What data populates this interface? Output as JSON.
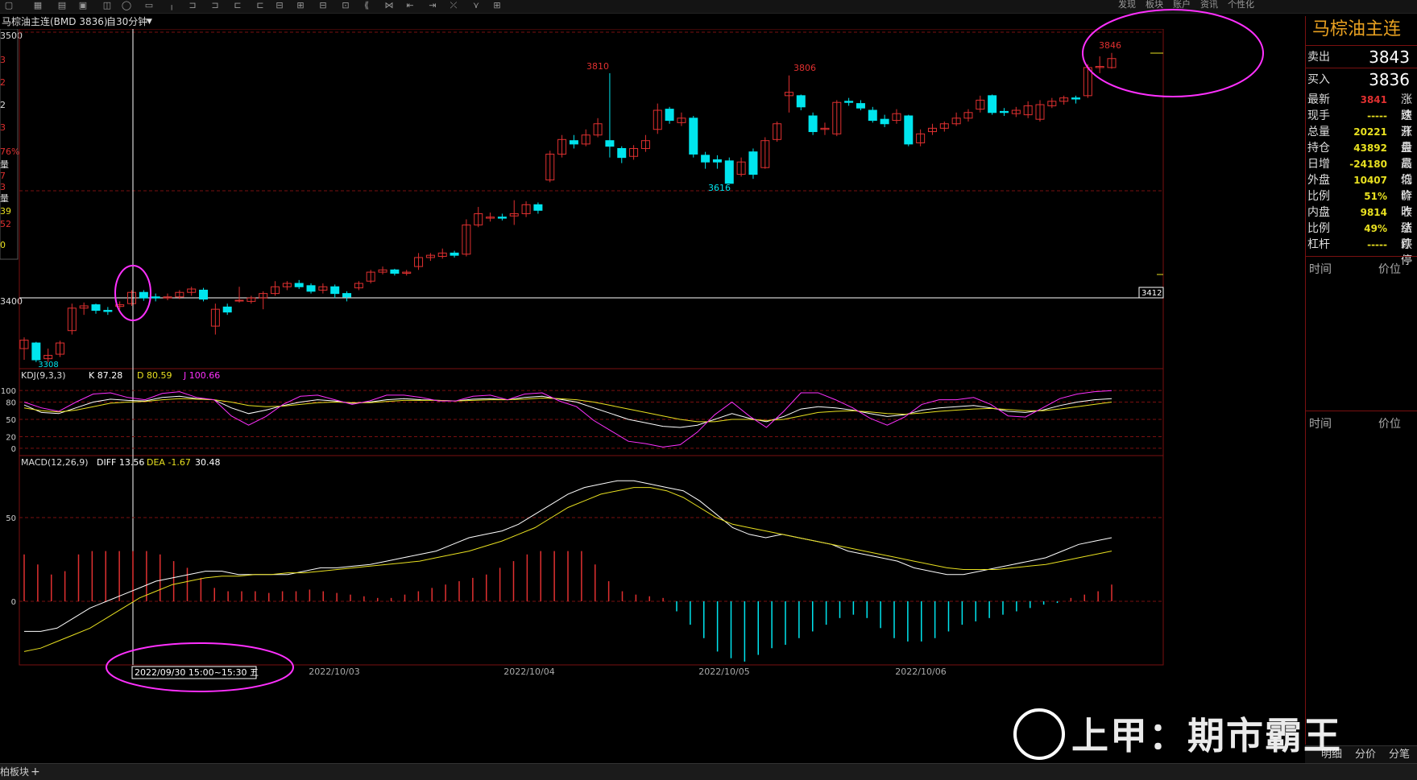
{
  "toolbar": {
    "right_items": [
      "发现",
      "板块",
      "账户",
      "资讯",
      "个性化"
    ]
  },
  "chart": {
    "instrument": "马棕油主连(BMD 3836)",
    "period": "自30分钟",
    "kdj_label": "KDJ(9,3,3)",
    "kdj_k": "K 87.28",
    "kdj_d": "D 80.59",
    "kdj_j": "J 100.66",
    "macd_label": "MACD(12,26,9)",
    "macd_diff": "DIFF 13.56",
    "macd_dea": "DEA -1.67",
    "macd_val": "30.48",
    "price_line_label": "3412",
    "crosshair_time": "2022/09/30 15:00~15:30 五",
    "date_labels": [
      "2022/10/03",
      "2022/10/04",
      "2022/10/05",
      "2022/10/06"
    ],
    "annotations": {
      "high1": "3810",
      "high2": "3806",
      "low1": "3616",
      "high3": "3846",
      "low_start": "3308"
    },
    "kdj_axis": [
      "100",
      "80",
      "50",
      "20",
      "0"
    ],
    "macd_axis": [
      "50",
      "0"
    ],
    "left_axis": [
      {
        "t": "3500",
        "c": "#ddd"
      },
      {
        "t": "3",
        "c": "#e03030"
      },
      {
        "t": "2",
        "c": "#e03030"
      },
      {
        "t": "2",
        "c": "#ddd"
      },
      {
        "t": "3",
        "c": "#e03030"
      },
      {
        "t": "76%",
        "c": "#e03030"
      },
      {
        "t": "量",
        "c": "#ddd"
      },
      {
        "t": "7",
        "c": "#e03030"
      },
      {
        "t": "3",
        "c": "#e03030"
      },
      {
        "t": "量",
        "c": "#ddd"
      },
      {
        "t": "39",
        "c": "#e8e020"
      },
      {
        "t": "52",
        "c": "#e03030"
      },
      {
        "t": "0",
        "c": "#e8e020"
      },
      {
        "t": "3400",
        "c": "#ddd"
      }
    ]
  },
  "side_panel": {
    "title": "马棕油主连",
    "sell_label": "卖出",
    "sell_price": "3843",
    "buy_label": "买入",
    "buy_price": "3836",
    "rows": [
      {
        "label": "最新",
        "value": "3841",
        "color": "#e03030",
        "tail": "涨跌"
      },
      {
        "label": "现手",
        "value": "-----",
        "color": "#e8e020",
        "tail": "速涨"
      },
      {
        "label": "总量",
        "value": "20221",
        "color": "#e8e020",
        "tail": "开盘"
      },
      {
        "label": "持仓",
        "value": "43892",
        "color": "#e8e020",
        "tail": "最高"
      },
      {
        "label": "日增",
        "value": "-24180",
        "color": "#e8e020",
        "tail": "最低"
      },
      {
        "label": "外盘",
        "value": "10407",
        "color": "#e8e020",
        "tail": "均价"
      },
      {
        "label": "比例",
        "value": "51%",
        "color": "#e8e020",
        "tail": "昨收"
      },
      {
        "label": "内盘",
        "value": "9814",
        "color": "#e8e020",
        "tail": "昨结"
      },
      {
        "label": "比例",
        "value": "49%",
        "color": "#e8e020",
        "tail": "涨停"
      },
      {
        "label": "杠杆",
        "value": "-----",
        "color": "#e8e020",
        "tail": "跌停"
      }
    ],
    "time_label": "时间",
    "price_label": "价位"
  },
  "bottom_tabs": [
    "明细",
    "分价",
    "分笔"
  ],
  "status": {
    "left": "柏板块"
  },
  "watermark": "上甲：期市霸王",
  "colors": {
    "up": "#e03030",
    "down": "#00e5ee",
    "highlight": "#ff30ff",
    "dea": "#e8e020",
    "diff": "#ffffff",
    "kdj_j": "#ff30ff"
  }
}
